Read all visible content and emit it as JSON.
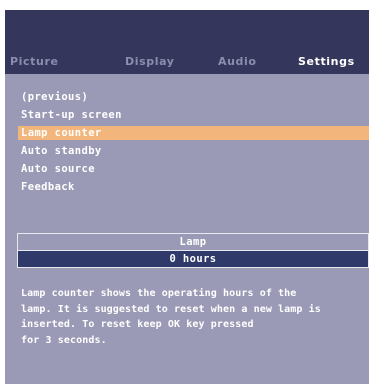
{
  "tabs": [
    "Picture",
    "Display",
    "Audio",
    "Settings"
  ],
  "active_tab": "Settings",
  "menu": {
    "items": [
      "(previous)",
      "Start-up screen",
      "Lamp counter",
      "Auto standby",
      "Auto source",
      "Feedback"
    ],
    "selected": "Lamp counter"
  },
  "lamp": {
    "title": "Lamp",
    "value": "0 hours"
  },
  "help": {
    "lines": [
      "Lamp counter shows the operating hours of the",
      "lamp. It is suggested to reset when a new lamp is",
      "inserted. To reset keep OK key pressed",
      "for 3 seconds."
    ]
  },
  "colors": {
    "header": "#35365b",
    "panel": "#9b9ab6",
    "highlight": "#f2b57c",
    "value_bar": "#2f3a6b"
  }
}
